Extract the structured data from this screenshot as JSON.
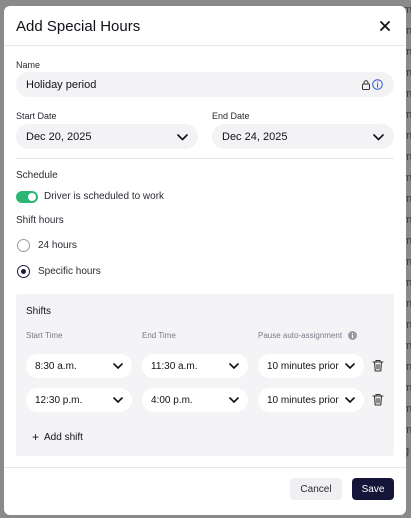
{
  "background_peek": [
    "m",
    "m",
    "m",
    "m",
    "m",
    "m",
    "m",
    "m",
    "m",
    "m",
    "m",
    "m",
    "m",
    "m",
    "m",
    "m",
    "m",
    "m",
    "m",
    "m",
    "m",
    "g"
  ],
  "modal": {
    "title": "Add Special Hours",
    "close_icon": "close-icon"
  },
  "name_field": {
    "label": "Name",
    "value": "Holiday period",
    "icons": [
      "lock-icon",
      "info-icon"
    ]
  },
  "start_date": {
    "label": "Start Date",
    "value": "Dec 20, 2025"
  },
  "end_date": {
    "label": "End Date",
    "value": "Dec 24, 2025"
  },
  "schedule": {
    "label": "Schedule",
    "toggle_on": true,
    "toggle_label": "Driver is scheduled to work"
  },
  "shift_hours": {
    "label": "Shift hours",
    "options": [
      {
        "label": "24 hours",
        "selected": false
      },
      {
        "label": "Specific hours",
        "selected": true
      }
    ]
  },
  "shifts": {
    "title": "Shifts",
    "columns": [
      "Start Time",
      "End Time",
      "Pause auto-assignment"
    ],
    "rows": [
      {
        "start": "8:30 a.m.",
        "end": "11:30 a.m.",
        "pause": "10 minutes prior"
      },
      {
        "start": "12:30 p.m.",
        "end": "4:00 p.m.",
        "pause": "10 minutes prior"
      }
    ],
    "add_label": "Add shift"
  },
  "footer": {
    "cancel_label": "Cancel",
    "save_label": "Save"
  },
  "colors": {
    "accent_dark": "#15153a",
    "toggle_green": "#2bb673",
    "info_blue": "#2d5bd6"
  }
}
